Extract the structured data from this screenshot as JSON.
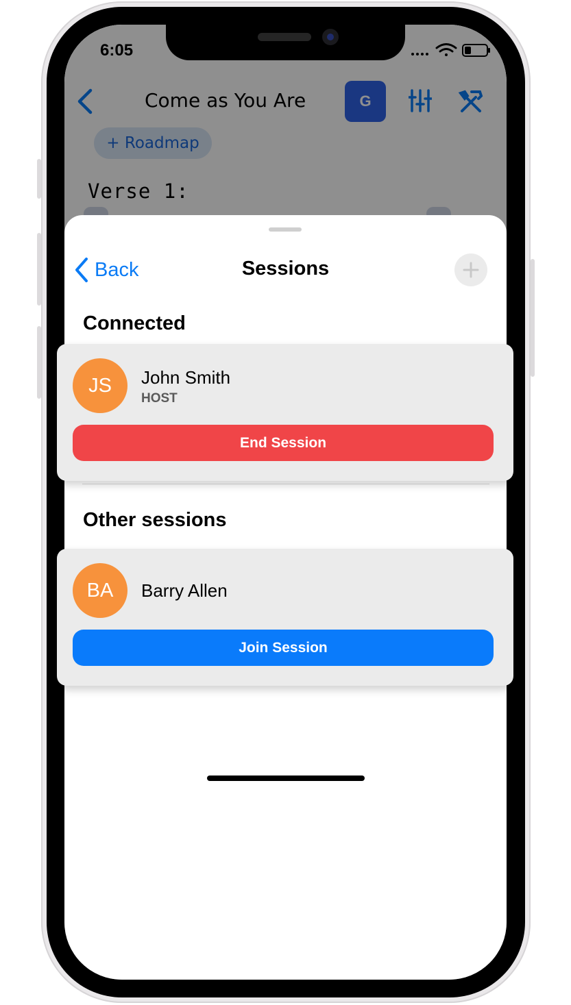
{
  "status_bar": {
    "time": "6:05"
  },
  "song_view": {
    "title": "Come as You Are",
    "key_button": "G",
    "roadmap_button": "+ Roadmap",
    "section_label": "Verse 1:"
  },
  "sessions_sheet": {
    "title": "Sessions",
    "back_label": "Back",
    "connected_heading": "Connected",
    "other_heading": "Other sessions",
    "connected": [
      {
        "initials": "JS",
        "name": "John Smith",
        "role": "HOST",
        "action": "End Session"
      }
    ],
    "other": [
      {
        "initials": "BA",
        "name": "Barry Allen",
        "action": "Join Session"
      }
    ]
  },
  "colors": {
    "accent_blue": "#0a7bfb",
    "danger_red": "#f04548",
    "avatar_orange": "#f7923c"
  },
  "icons": [
    "back-chevron-icon",
    "mixer-icon",
    "tools-icon",
    "plus-icon",
    "wifi-icon",
    "battery-icon",
    "cellular-icon"
  ]
}
